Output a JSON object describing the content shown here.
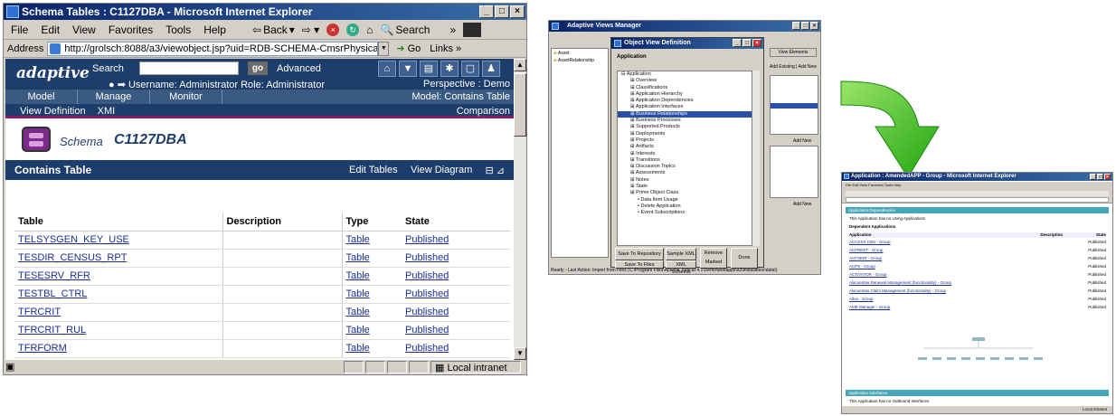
{
  "ie": {
    "title": "Schema Tables : C1127DBA - Microsoft Internet Explorer",
    "menu": [
      "File",
      "Edit",
      "View",
      "Favorites",
      "Tools",
      "Help"
    ],
    "nav": {
      "back": "Back",
      "search": "Search"
    },
    "address_label": "Address",
    "url": "http://grolsch:8088/a3/viewobject.jsp?uid=RDB-SCHEMA-CmsrPhysical.C1127DBA&ovuid",
    "go": "Go",
    "links": "Links",
    "status_zone": "Local intranet"
  },
  "app": {
    "logo": "adaptive",
    "search_label": "Search",
    "search_value": "",
    "go_label": "go",
    "advanced": "Advanced",
    "user_line": "Username: Administrator  Role: Administrator",
    "perspective": "Perspective : Demo",
    "tabs": [
      "Model",
      "Manage",
      "Monitor"
    ],
    "model_label": "Model: Contains Table",
    "subnav": [
      "View Definition",
      "XMI"
    ],
    "comparison": "Comparison",
    "schema_label": "Schema",
    "schema_name": "C1127DBA",
    "section_title": "Contains Table",
    "edit_tables": "Edit Tables",
    "view_diagram": "View Diagram",
    "columns": [
      "Table",
      "Description",
      "Type",
      "State"
    ],
    "rows": [
      {
        "table": "TELSYSGEN_KEY_USE",
        "description": "",
        "type": "Table",
        "state": "Published"
      },
      {
        "table": "TESDIR_CENSUS_RPT",
        "description": "",
        "type": "Table",
        "state": "Published"
      },
      {
        "table": "TESESRV_RFR",
        "description": "",
        "type": "Table",
        "state": "Published"
      },
      {
        "table": "TESTBL_CTRL",
        "description": "",
        "type": "Table",
        "state": "Published"
      },
      {
        "table": "TFRCRIT",
        "description": "",
        "type": "Table",
        "state": "Published"
      },
      {
        "table": "TFRCRIT_RUL",
        "description": "",
        "type": "Table",
        "state": "Published"
      },
      {
        "table": "TFRFORM",
        "description": "",
        "type": "Table",
        "state": "Published"
      }
    ]
  },
  "manager": {
    "title": "Adaptive Views Manager",
    "dialog_title": "Object View Definition",
    "dialog_heading": "Application",
    "left_items": [
      "Asset",
      "AssetRelationship"
    ],
    "tabs": [
      "View Elements"
    ],
    "buttons_right": [
      "Add Existing",
      "Add New"
    ],
    "add_new_2": "Add New",
    "add_new_3": "Add New",
    "tree": [
      "Application",
      "Overview",
      "Classifications",
      "Application Hierarchy",
      "Application Dependencies",
      "Application Interfaces",
      "Business Relationships",
      "Business Processes",
      "Supported Products",
      "Deployments",
      "Projects",
      "Artifacts",
      "Interests",
      "Transitions",
      "Discussion Topics",
      "Assessments",
      "Notes",
      "State",
      "Prime Object Class",
      "Data Item Usage",
      "Delete Application",
      "Event Subscriptions"
    ],
    "selected_index": 6,
    "dialog_buttons": [
      "Save To Repository",
      "Sample XML",
      "Save To Files",
      "XML Schema",
      "Remove Marked",
      "Done"
    ],
    "status": "Ready - Last Action: Import from Files (C:\\Program Files\\Apache Tomcat 4.1\\Demo\\webapps\\a3\\installation\\data\\)"
  },
  "colors": {
    "arrow": "#2fbf1f",
    "header": "#1d3d6b",
    "accent": "#8a1a6a"
  },
  "small": {
    "title": "Application : AmendedAPP - Group - Microsoft Internet Explorer",
    "section1": "Application Dependencies",
    "sub1": "This Application has no Using Applications",
    "sub2": "Dependent Applications",
    "columns": [
      "Application",
      "Description",
      "State"
    ],
    "rows": [
      "ACCESS CBS - Group",
      "ACFREST - Group",
      "ACFSEIR - Group",
      "ACPS - Group",
      "ACTIVATOR - Group",
      "Alacuentas Renewal Management (functionality) - Group",
      "Alacuentas Claim Management (functionality) - Group",
      "Albia - Group",
      "AME Manager - Group"
    ],
    "state": "Published",
    "section2": "Application Interfaces",
    "sub3": "This Application has no Outbound Interfaces",
    "status": "Local intranet"
  }
}
